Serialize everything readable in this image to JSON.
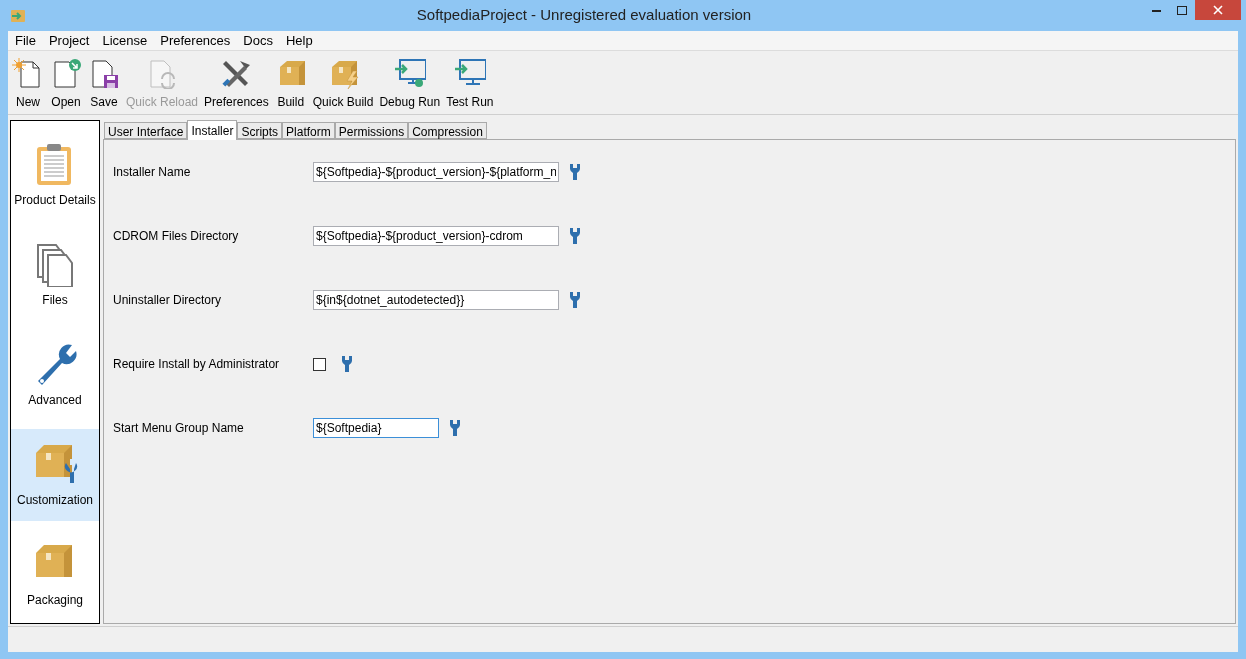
{
  "window": {
    "title": "SoftpediaProject - Unregistered evaluation version"
  },
  "menu": [
    "File",
    "Project",
    "License",
    "Preferences",
    "Docs",
    "Help"
  ],
  "toolbar": [
    {
      "label": "New",
      "kind": "new",
      "disabled": false
    },
    {
      "label": "Open",
      "kind": "open",
      "disabled": false
    },
    {
      "label": "Save",
      "kind": "save",
      "disabled": false
    },
    {
      "label": "Quick Reload",
      "kind": "reload",
      "disabled": true
    },
    {
      "label": "Preferences",
      "kind": "tools",
      "disabled": false
    },
    {
      "label": "Build",
      "kind": "box",
      "disabled": false
    },
    {
      "label": "Quick Build",
      "kind": "quickbox",
      "disabled": false
    },
    {
      "label": "Debug Run",
      "kind": "debug",
      "disabled": false
    },
    {
      "label": "Test Run",
      "kind": "run",
      "disabled": false
    }
  ],
  "sidebar": {
    "items": [
      {
        "label": "Product Details",
        "kind": "clipboard",
        "selected": false
      },
      {
        "label": "Files",
        "kind": "files",
        "selected": false
      },
      {
        "label": "Advanced",
        "kind": "wrench",
        "selected": false
      },
      {
        "label": "Customization",
        "kind": "boxwrench",
        "selected": true
      },
      {
        "label": "Packaging",
        "kind": "box",
        "selected": false
      }
    ]
  },
  "tabs": [
    {
      "label": "User Interface",
      "selected": false
    },
    {
      "label": "Installer",
      "selected": true
    },
    {
      "label": "Scripts",
      "selected": false
    },
    {
      "label": "Platform",
      "selected": false
    },
    {
      "label": "Permissions",
      "selected": false
    },
    {
      "label": "Compression",
      "selected": false
    }
  ],
  "fields": [
    {
      "label": "Installer Name",
      "kind": "text",
      "value": "${Softpedia}-${product_version}-${platform_n",
      "focused": false
    },
    {
      "label": "CDROM Files Directory",
      "kind": "text",
      "value": "${Softpedia}-${product_version}-cdrom",
      "focused": false
    },
    {
      "label": "Uninstaller Directory",
      "kind": "text",
      "value": "${in${dotnet_autodetected}}",
      "focused": false
    },
    {
      "label": "Require Install by Administrator",
      "kind": "checkbox",
      "checked": false
    },
    {
      "label": "Start Menu Group Name",
      "kind": "short_text",
      "value": "${Softpedia}",
      "focused": true
    }
  ]
}
